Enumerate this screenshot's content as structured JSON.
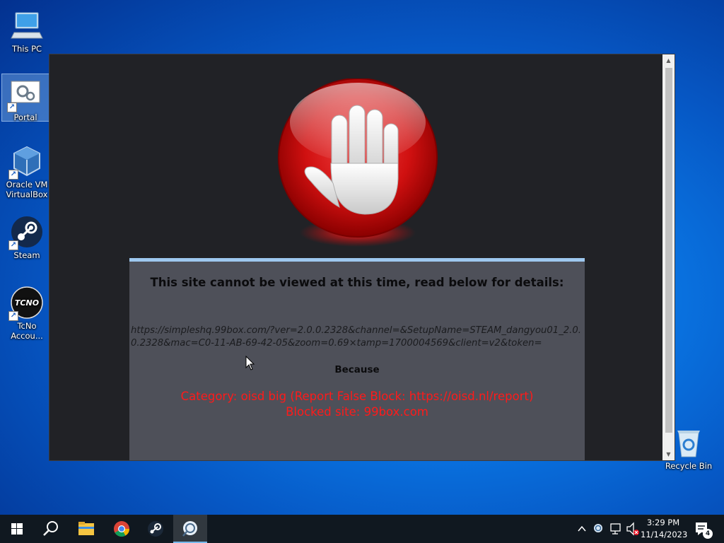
{
  "desktop": {
    "icons": [
      {
        "label": "This PC"
      },
      {
        "label": "Portal"
      },
      {
        "label": "Oracle VM VirtualBox"
      },
      {
        "label": "Steam"
      },
      {
        "label": "TcNo Accou..."
      },
      {
        "label": "Recycle Bin"
      }
    ]
  },
  "block_page": {
    "heading": "This site cannot be viewed at this time, read below for details:",
    "url": "https://simpleshq.99box.com/?ver=2.0.0.2328&channel=&SetupName=STEAM_dangyou01_2.0.0.2328&mac=C0-11-AB-69-42-05&zoom=0.69×tamp=1700004569&client=v2&token=",
    "because": "Because",
    "category": "Category: oisd big (Report False Block: https://oisd.nl/report)",
    "blocked_site": "Blocked site: 99box.com",
    "colors": {
      "error_text": "#ff1a1a",
      "panel_bg": "#4e5059",
      "panel_accent": "#9ec8ef",
      "page_bg": "#212226"
    }
  },
  "taskbar": {
    "clock_time": "3:29 PM",
    "clock_date": "11/14/2023",
    "notification_count": "4",
    "pinned": [
      "start-icon",
      "search-icon",
      "file-explorer-icon",
      "chrome-icon",
      "steam-icon",
      "portal-icon"
    ]
  }
}
